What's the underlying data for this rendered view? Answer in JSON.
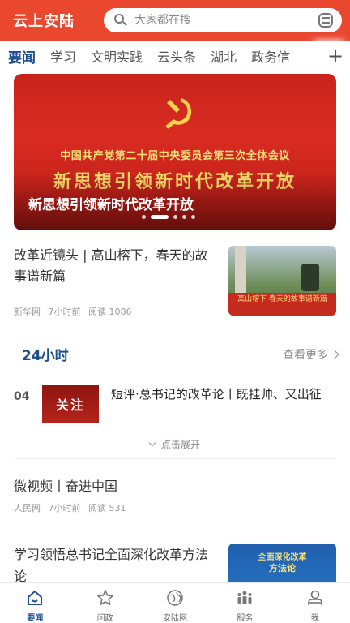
{
  "header": {
    "app_title": "云上安陆",
    "search_placeholder": "大家都在搜",
    "accent_color": "#e9472e"
  },
  "tabs": [
    {
      "label": "要闻",
      "active": true
    },
    {
      "label": "学习"
    },
    {
      "label": "文明实践"
    },
    {
      "label": "云头条"
    },
    {
      "label": "湖北"
    },
    {
      "label": "政务信"
    }
  ],
  "tabs_add": "+",
  "banner": {
    "image_subtitle": "中国共产党第二十届中央委员会第三次全体会议",
    "image_headline": "新思想引领新时代改革开放",
    "caption": "新思想引领新时代改革开放",
    "slide_count": 5,
    "active_slide": 1
  },
  "article_1": {
    "title": "改革近镜头 | 高山榕下，春天的故事谱新篇",
    "source": "新华网",
    "time": "7小时前",
    "reads": "阅读 1086",
    "thumb_text": "高山榕下 春天的故事谱新篇"
  },
  "hot": {
    "section_title": "24小时",
    "see_more": "查看更多",
    "rank": "04",
    "thumb_text": "关注",
    "title": "短评·总书记的改革论丨既挂帅、又出征",
    "expand_label": "点击展开"
  },
  "article_2": {
    "title": "微视频丨奋进中国",
    "source": "人民网",
    "time": "7小时前",
    "reads": "阅读 531"
  },
  "article_3": {
    "title": "学习领悟总书记全面深化改革方法论",
    "thumb_line1": "全面深化改革",
    "thumb_line2": "方法论"
  },
  "bottom_nav": [
    {
      "label": "要闻",
      "icon": "home-icon",
      "active": true
    },
    {
      "label": "问政",
      "icon": "star-icon"
    },
    {
      "label": "安陆网",
      "icon": "globe-icon"
    },
    {
      "label": "服务",
      "icon": "people-icon"
    },
    {
      "label": "我",
      "icon": "user-icon"
    }
  ]
}
